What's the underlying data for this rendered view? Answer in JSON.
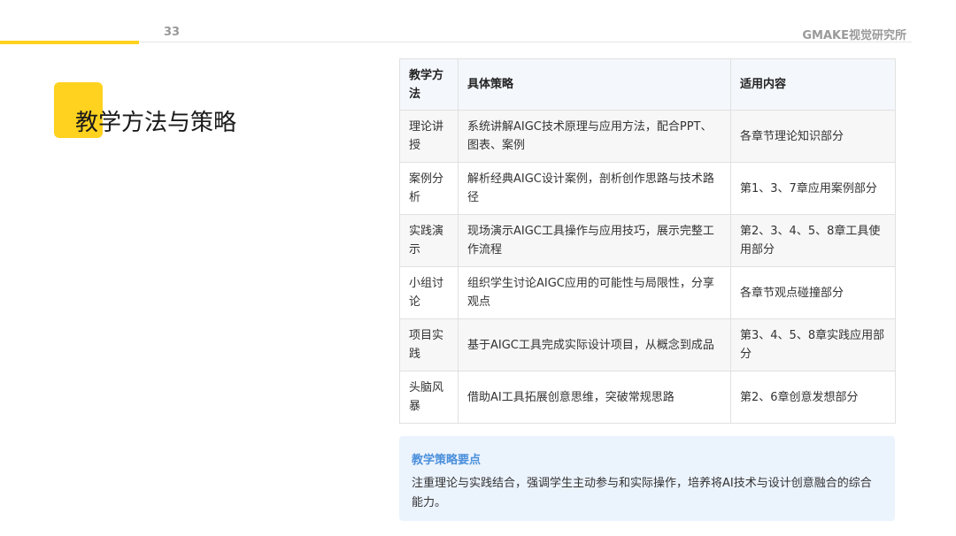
{
  "header": {
    "page_number": "33",
    "brand": "GMAKE视觉研究所"
  },
  "title": "教学方法与策略",
  "table": {
    "headers": [
      "教学方法",
      "具体策略",
      "适用内容"
    ],
    "rows": [
      [
        "理论讲授",
        "系统讲解AIGC技术原理与应用方法，配合PPT、图表、案例",
        "各章节理论知识部分"
      ],
      [
        "案例分析",
        "解析经典AIGC设计案例，剖析创作思路与技术路径",
        "第1、3、7章应用案例部分"
      ],
      [
        "实践演示",
        "现场演示AIGC工具操作与应用技巧，展示完整工作流程",
        "第2、3、4、5、8章工具使用部分"
      ],
      [
        "小组讨论",
        "组织学生讨论AIGC应用的可能性与局限性，分享观点",
        "各章节观点碰撞部分"
      ],
      [
        "项目实践",
        "基于AIGC工具完成实际设计项目，从概念到成品",
        "第3、4、5、8章实践应用部分"
      ],
      [
        "头脑风暴",
        "借助AI工具拓展创意思维，突破常规思路",
        "第2、6章创意发想部分"
      ]
    ]
  },
  "callout": {
    "title": "教学策略要点",
    "body": "注重理论与实践结合，强调学生主动参与和实际操作，培养将AI技术与设计创意融合的综合能力。"
  },
  "colors": {
    "accent": "#ffd21f",
    "callout_title": "#4a8fdb",
    "callout_bg": "#ebf3fd"
  }
}
